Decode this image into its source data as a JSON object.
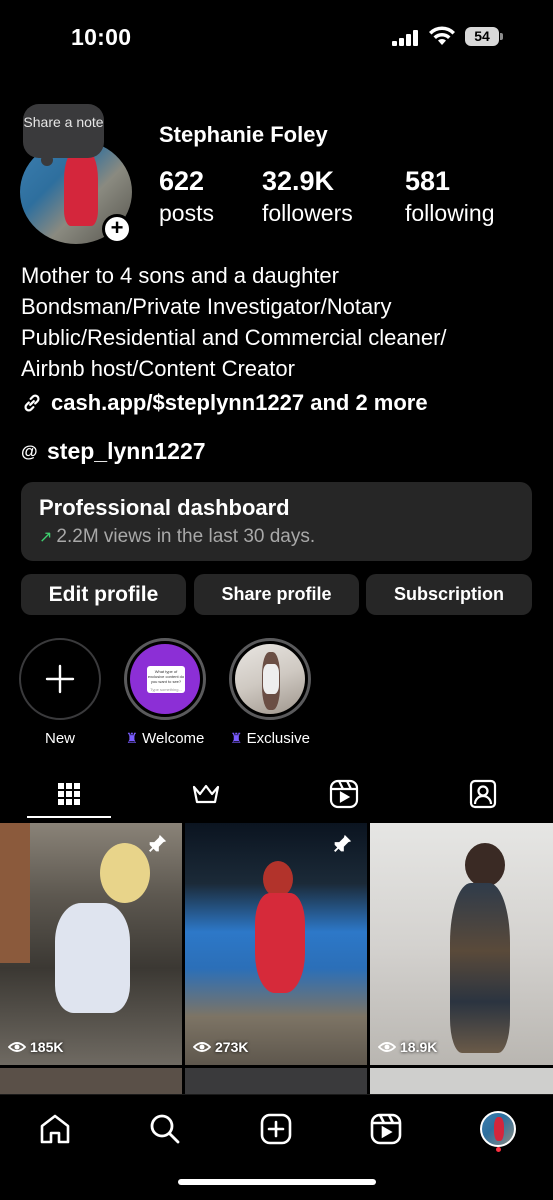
{
  "status_bar": {
    "time": "10:00",
    "battery": "54"
  },
  "profile": {
    "name": "Stephanie Foley",
    "note_label": "Share a note",
    "stats": [
      {
        "value": "622",
        "label": "posts"
      },
      {
        "value": "32.9K",
        "label": "followers"
      },
      {
        "value": "581",
        "label": "following"
      }
    ],
    "bio_lines": [
      "Mother to 4 sons and a daughter",
      "Bondsman/Private Investigator/Notary",
      "Public/Residential and Commercial cleaner/",
      "Airbnb host/Content Creator"
    ],
    "link": "cash.app/$steplynn1227 and 2 more",
    "threads_handle": "step_lynn1227"
  },
  "dashboard": {
    "title": "Professional dashboard",
    "subtitle": "2.2M views in the last 30 days."
  },
  "buttons": {
    "edit": "Edit profile",
    "share": "Share profile",
    "subscription": "Subscription"
  },
  "highlights": [
    {
      "label": "New"
    },
    {
      "label": "Welcome"
    },
    {
      "label": "Exclusive"
    }
  ],
  "highlight_text": {
    "welcome_q": "What type of exclusive content do you want to see?",
    "welcome_placeholder": "Type something..."
  },
  "tabs": [
    "grid-icon",
    "crown-icon",
    "reels-icon",
    "tagged-icon"
  ],
  "posts": [
    {
      "views": "185K",
      "pinned": true
    },
    {
      "views": "273K",
      "pinned": true
    },
    {
      "views": "18.9K",
      "pinned": false
    }
  ],
  "colors": {
    "accent_purple": "#7a5cff",
    "trend_green": "#3ecf6f",
    "notification_red": "#ff3040",
    "card_bg": "#262626"
  }
}
